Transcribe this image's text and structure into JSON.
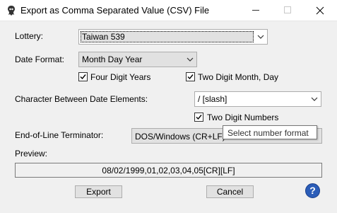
{
  "window": {
    "title": "Export as Comma Separated Value (CSV) File",
    "controls": {
      "minimize": "—",
      "maximize": "☐",
      "close": "✕"
    }
  },
  "lottery": {
    "label": "Lottery:",
    "value": "Taiwan 539"
  },
  "date_format": {
    "label": "Date Format:",
    "value": "Month Day Year",
    "four_digit_years": {
      "label": "Four Digit Years",
      "checked": true
    },
    "two_digit_month_day": {
      "label": "Two Digit Month, Day",
      "checked": true
    }
  },
  "char_between": {
    "label": "Character Between Date Elements:",
    "value": "/ [slash]",
    "two_digit_numbers": {
      "label": "Two Digit Numbers",
      "checked": true
    }
  },
  "eol": {
    "label": "End-of-Line Terminator:",
    "value": "DOS/Windows (CR+LF)"
  },
  "tooltip": {
    "text": "Select number format"
  },
  "preview": {
    "label": "Preview:",
    "value": "08/02/1999,01,02,03,04,05[CR][LF]"
  },
  "buttons": {
    "export": "Export",
    "cancel": "Cancel",
    "help": "?"
  },
  "colors": {
    "checkmark": "#000000",
    "help_bg": "#2b5db8"
  }
}
